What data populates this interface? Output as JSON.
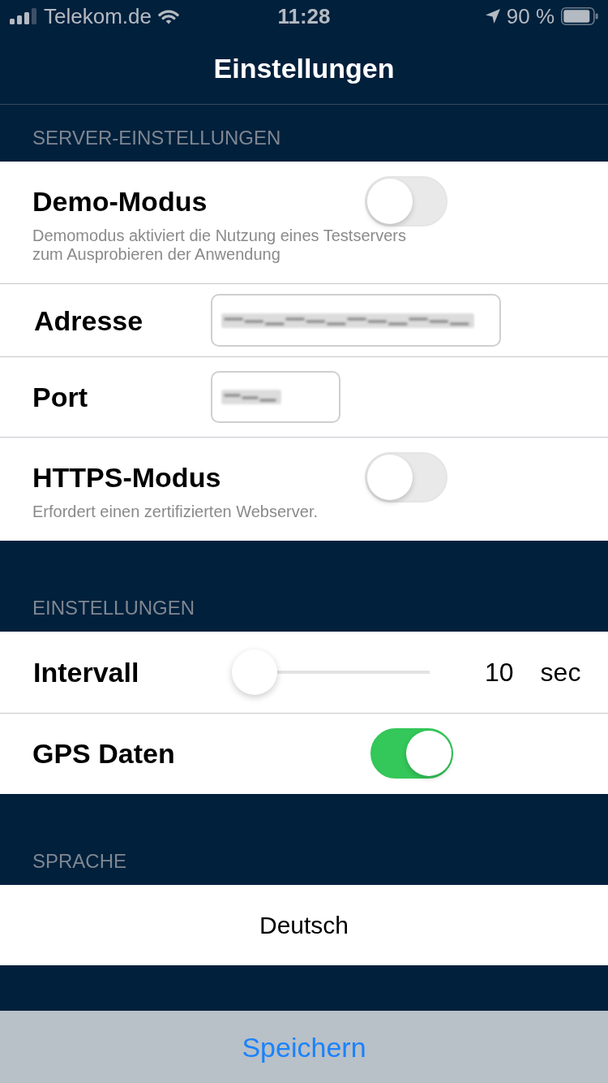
{
  "status_bar": {
    "carrier": "Telekom.de",
    "time": "11:28",
    "battery": "90 %"
  },
  "nav_bar": {
    "title": "Einstellungen"
  },
  "sections": [
    {
      "header": "SERVER-EINSTELLUNGEN",
      "rows": [
        {
          "kind": "toggle",
          "label": "Demo-Modus",
          "description": "Demomodus aktiviert die Nutzung eines Testservers zum Ausprobieren der Anwendung",
          "on": false
        },
        {
          "kind": "text_field",
          "label": "Adresse",
          "value_blurred": true
        },
        {
          "kind": "number_field",
          "label": "Port",
          "value_blurred": true
        },
        {
          "kind": "toggle",
          "label": "HTTPS-Modus",
          "description": "Erfordert einen zertifizierten Webserver.",
          "on": false
        }
      ]
    },
    {
      "header": "EINSTELLUNGEN",
      "rows": [
        {
          "kind": "slider",
          "label": "Intervall",
          "level": 0,
          "value": "10",
          "unit": "sec"
        },
        {
          "kind": "toggle",
          "label": "GPS Daten",
          "on": true
        }
      ]
    },
    {
      "header": "SPRACHE",
      "rows": [
        {
          "kind": "choice",
          "label": "Deutsch"
        }
      ]
    }
  ],
  "footer_button": {
    "label": "Speichern"
  }
}
